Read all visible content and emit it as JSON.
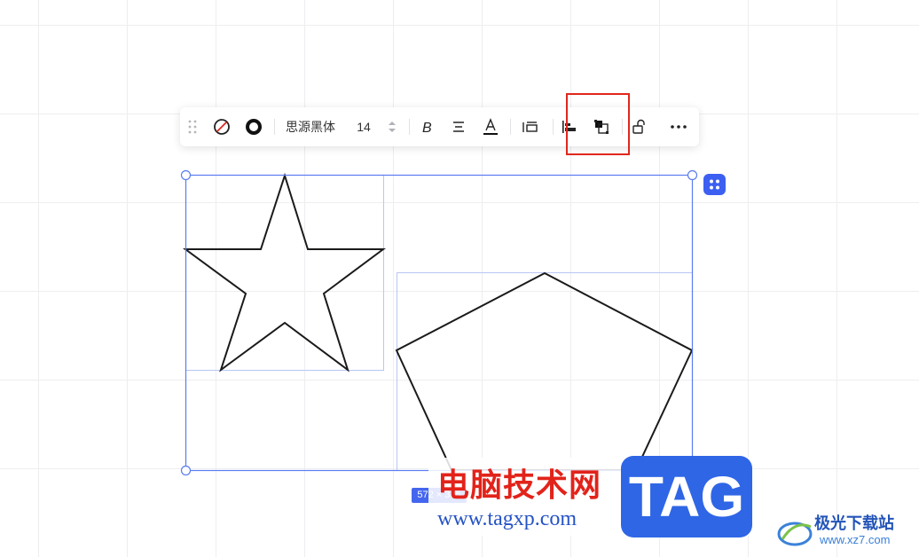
{
  "toolbar": {
    "font_family": "思源黑体",
    "font_size": "14",
    "items": [
      {
        "name": "drag-handle-icon"
      },
      {
        "name": "no-fill-icon"
      },
      {
        "name": "stroke-style-icon"
      },
      {
        "name": "font-family-select"
      },
      {
        "name": "font-size-stepper"
      },
      {
        "name": "bold-icon"
      },
      {
        "name": "text-align-icon"
      },
      {
        "name": "font-color-icon"
      },
      {
        "name": "spacing-icon"
      },
      {
        "name": "align-left-icon"
      },
      {
        "name": "group-icon"
      },
      {
        "name": "unlock-icon"
      },
      {
        "name": "more-icon"
      }
    ]
  },
  "selection": {
    "size_label": "572 × 335"
  },
  "colors": {
    "selection_blue": "#5b7cf0",
    "badge_blue": "#3c5ff2",
    "highlight_red": "#e0271d"
  },
  "watermark": {
    "title": "电脑技术网",
    "url": "www.tagxp.com",
    "tag": "TAG",
    "logo_cn": "极光下载站",
    "logo_url": "www.xz7.com"
  }
}
